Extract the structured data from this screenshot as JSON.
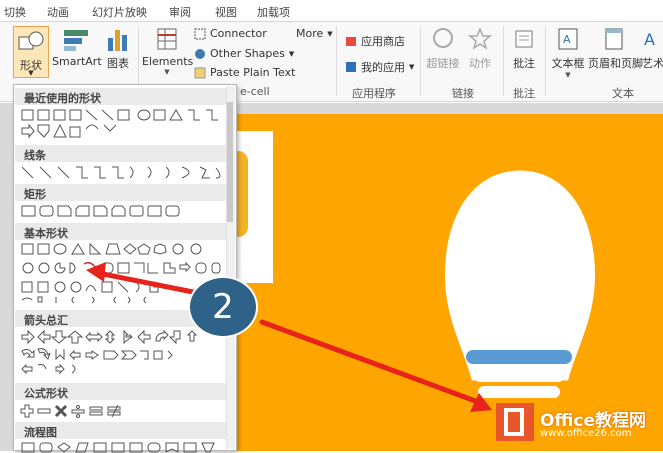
{
  "tabs": [
    "切换",
    "动画",
    "幻灯片放映",
    "审阅",
    "视图",
    "加载项"
  ],
  "ribbon": {
    "shapes": {
      "label": "形状"
    },
    "smartart": {
      "label": "SmartArt"
    },
    "chart": {
      "label": "图表"
    },
    "elements": {
      "label": "Elements"
    },
    "connector": "Connector",
    "more": "More",
    "other_shapes": "Other Shapes",
    "paste_plain": "Paste Plain Text",
    "ecell": "e-cell",
    "app_store": "应用商店",
    "my_apps": "我的应用",
    "hyperlink": "超链接",
    "action": "动作",
    "comment": "批注",
    "textbox": "文本框",
    "header_footer": "页眉和页脚",
    "art": "艺术",
    "groups": {
      "apps": "应用程序",
      "links": "链接",
      "comments": "批注",
      "text": "文本"
    }
  },
  "dropdown": {
    "sections": {
      "recent": "最近使用的形状",
      "lines": "线条",
      "rect": "矩形",
      "basic": "基本形状",
      "arrows": "箭头总汇",
      "equation": "公式形状",
      "flowchart": "流程图"
    }
  },
  "callout": {
    "number": "2"
  },
  "watermark": {
    "brand": "Office教程网",
    "url": "www.office26.com"
  },
  "colors": {
    "slide": "#ffa500",
    "callout": "#2f6288",
    "arrow": "#e8231b",
    "bulb_band": "#5b9bd5"
  }
}
